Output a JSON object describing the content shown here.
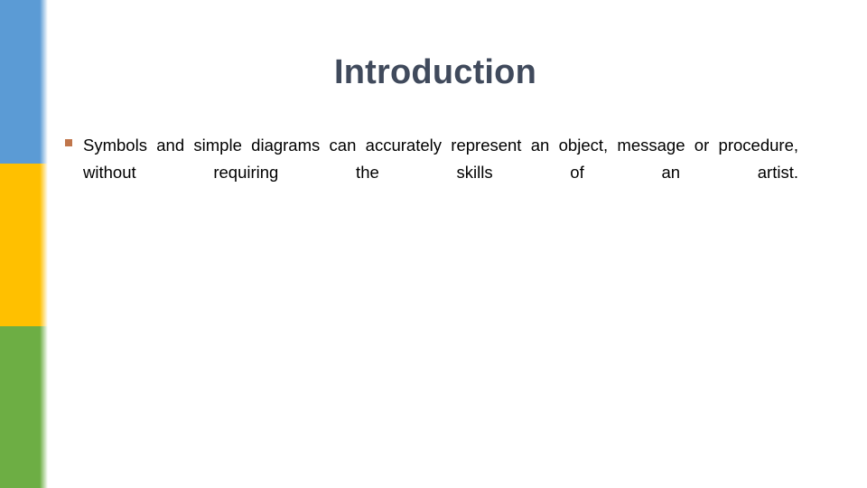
{
  "slide": {
    "title": "Introduction",
    "background_color": "#FFFFFF",
    "title_color": "#404A5C"
  },
  "accent_bar": {
    "segments": [
      {
        "name": "blue",
        "color": "#5B9BD5"
      },
      {
        "name": "yellow",
        "color": "#FFC000"
      },
      {
        "name": "green",
        "color": "#6DAE44"
      }
    ]
  },
  "body": {
    "bullets": [
      {
        "marker": "square-bullet",
        "marker_color": "#C0764B",
        "text": "Symbols and simple diagrams can accurately represent an object, message or procedure, without requiring the skills of an artist."
      }
    ]
  }
}
